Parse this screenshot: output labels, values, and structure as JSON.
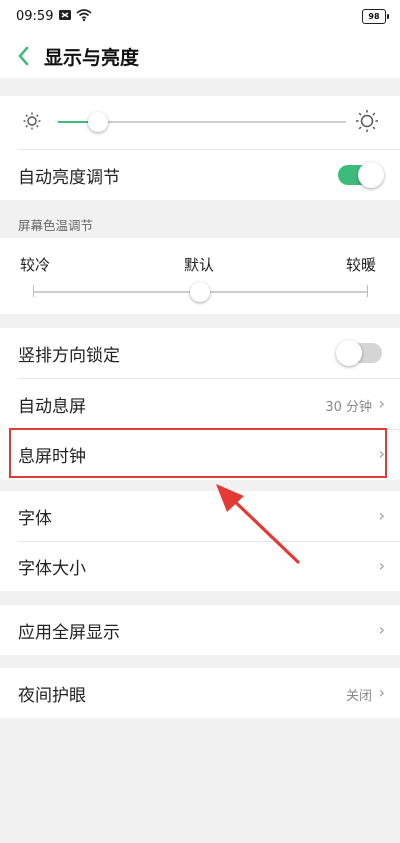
{
  "status_bar": {
    "time": "09:59",
    "battery": "98"
  },
  "header": {
    "title": "显示与亮度",
    "accent": "#3dbb7b"
  },
  "brightness": {
    "level": 0.14
  },
  "auto_brightness": {
    "label": "自动亮度调节",
    "on": true
  },
  "color_temp": {
    "section_title": "屏幕色温调节",
    "cool_label": "较冷",
    "default_label": "默认",
    "warm_label": "较暖",
    "level": 0.5
  },
  "rows": {
    "orientation_lock": {
      "label": "竖排方向锁定",
      "on": false
    },
    "auto_sleep": {
      "label": "自动息屏",
      "value": "30 分钟"
    },
    "aod_clock": {
      "label": "息屏时钟"
    },
    "font": {
      "label": "字体"
    },
    "font_size": {
      "label": "字体大小"
    },
    "fullscreen_apps": {
      "label": "应用全屏显示"
    },
    "night_mode": {
      "label": "夜间护眼",
      "value": "关闭"
    }
  },
  "annotation": {
    "color": "#e53935"
  }
}
